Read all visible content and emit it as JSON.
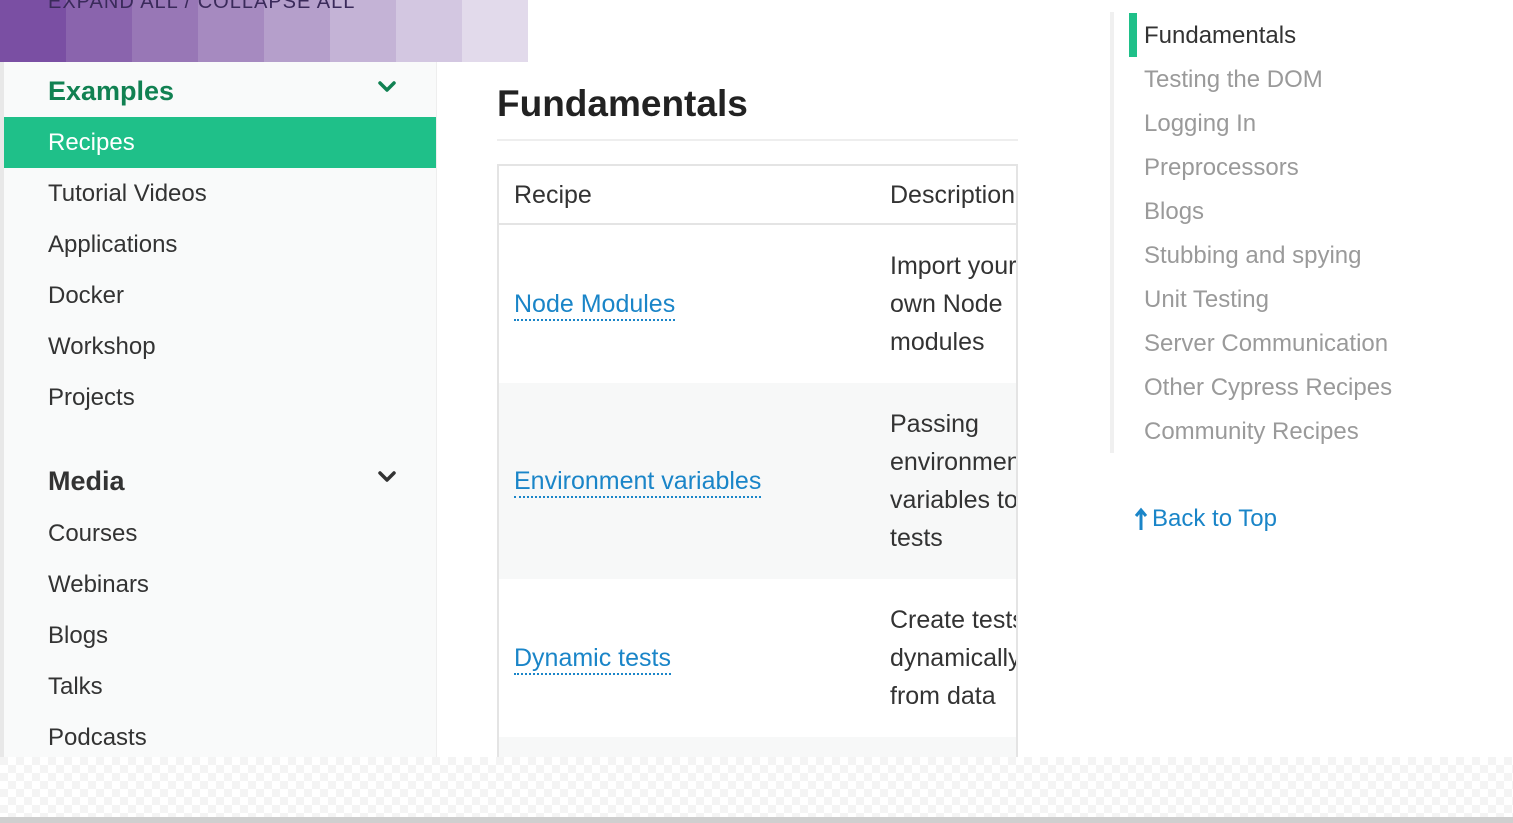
{
  "top_strip": {
    "text": "EXPAND ALL   /   COLLAPSE ALL",
    "colors": [
      "#7a4fa3",
      "#8a64ad",
      "#9877b6",
      "#a68ac0",
      "#b59fcb",
      "#c4b3d6",
      "#d3c7e1",
      "#e2daeb"
    ]
  },
  "sidebar": {
    "examples_heading": "Examples",
    "examples_items": [
      {
        "label": "Recipes",
        "active": true
      },
      {
        "label": "Tutorial Videos"
      },
      {
        "label": "Applications"
      },
      {
        "label": "Docker"
      },
      {
        "label": "Workshop"
      },
      {
        "label": "Projects"
      }
    ],
    "media_heading": "Media",
    "media_items": [
      {
        "label": "Courses"
      },
      {
        "label": "Webinars"
      },
      {
        "label": "Blogs"
      },
      {
        "label": "Talks"
      },
      {
        "label": "Podcasts"
      }
    ],
    "chevron_icon": "chevron-down-icon"
  },
  "main": {
    "title": "Fundamentals",
    "table": {
      "headers": [
        "Recipe",
        "Description"
      ],
      "rows": [
        {
          "recipe": "Node Modules",
          "description": [
            "Import your",
            "own Node",
            "modules"
          ]
        },
        {
          "recipe": "Environment variables",
          "description": [
            "Passing",
            "environment",
            "variables to",
            "tests"
          ]
        },
        {
          "recipe": "Dynamic tests",
          "description": [
            "Create tests",
            "dynamically",
            "from data"
          ]
        }
      ]
    }
  },
  "toc": {
    "items": [
      "Fundamentals",
      "Testing the DOM",
      "Logging In",
      "Preprocessors",
      "Blogs",
      "Stubbing and spying",
      "Unit Testing",
      "Server Communication",
      "Other Cypress Recipes",
      "Community Recipes"
    ],
    "active_index": 0,
    "back_to_top": "Back to Top"
  },
  "colors": {
    "accent_green": "#1fc089",
    "heading_green": "#118152",
    "link_blue": "#1a85c8"
  }
}
